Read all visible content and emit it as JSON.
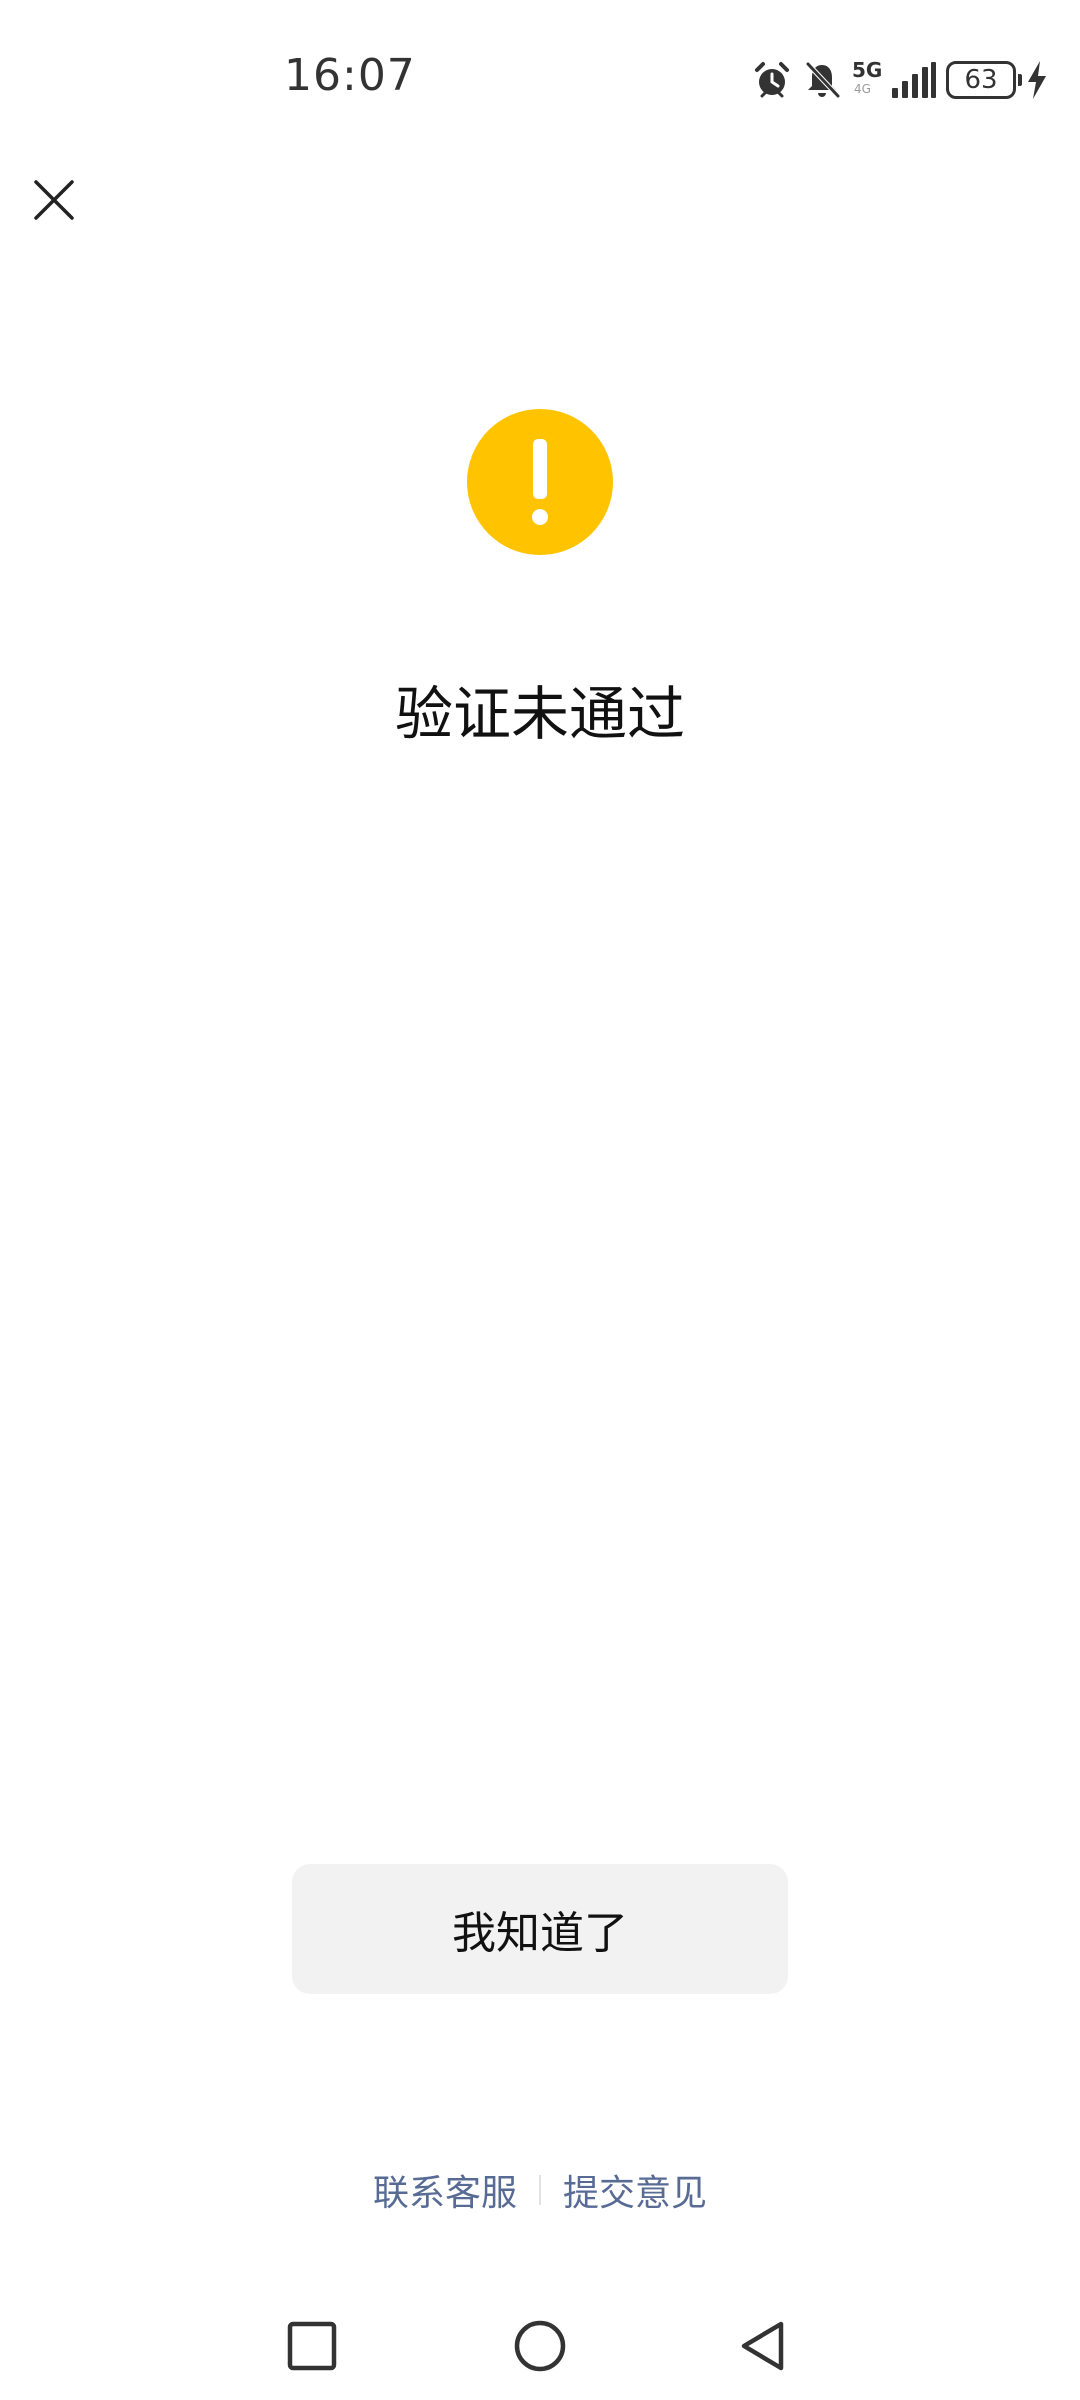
{
  "status_bar": {
    "time": "16:07",
    "network_type": "5G",
    "network_sub": "4G",
    "battery": "63",
    "icons": [
      "alarm-icon",
      "bell-off-icon",
      "signal-icon",
      "battery-icon",
      "charging-icon"
    ]
  },
  "dialog": {
    "close_icon": "close-icon",
    "status_icon": "warning-icon",
    "status_color": "#FFC300",
    "title": "验证未通过",
    "ack_button": "我知道了"
  },
  "footer": {
    "links": [
      "联系客服",
      "提交意见"
    ],
    "link_color": "#576B95"
  },
  "nav_bar": {
    "icons": [
      "recent-apps-icon",
      "home-icon",
      "back-icon"
    ]
  }
}
